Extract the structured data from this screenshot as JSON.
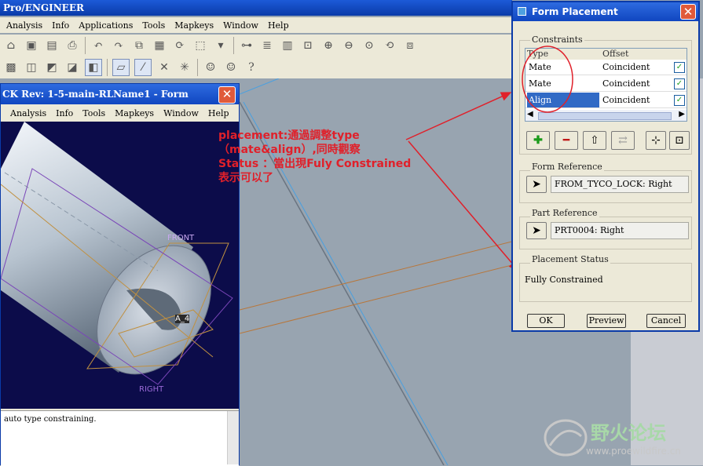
{
  "main_window": {
    "title": "Pro/ENGINEER",
    "menu": [
      "Analysis",
      "Info",
      "Applications",
      "Tools",
      "Mapkeys",
      "Window",
      "Help"
    ]
  },
  "form_window": {
    "title": "CK Rev: 1-5-main-RLName1 - Form",
    "menu": [
      "Analysis",
      "Info",
      "Tools",
      "Mapkeys",
      "Window",
      "Help"
    ],
    "close": "✕",
    "datum_labels": {
      "front": "FRONT",
      "right": "RIGHT",
      "axis": "A_4"
    },
    "message": "auto type constraining."
  },
  "dialog": {
    "title": "Form Placement",
    "close": "✕",
    "constraints_label": "Constraints",
    "columns": {
      "type": "Type",
      "offset": "Offset"
    },
    "rows": [
      {
        "type": "Mate",
        "offset": "Coincident",
        "checked": "✓"
      },
      {
        "type": "Mate",
        "offset": "Coincident",
        "checked": "✓"
      },
      {
        "type": "Align",
        "offset": "Coincident",
        "checked": "✓"
      }
    ],
    "form_reference_label": "Form Reference",
    "form_reference_value": "FROM_TYCO_LOCK: Right",
    "part_reference_label": "Part Reference",
    "part_reference_value": "PRT0004: Right",
    "placement_status_label": "Placement Status",
    "placement_status_value": "Fully Constrained",
    "ok": "OK",
    "preview": "Preview",
    "cancel": "Cancel"
  },
  "annotation": {
    "line1": "placement:通過調整type",
    "line2": "（mate&align）,同時觀察",
    "line3": "Status ：當出現Fuly Constrained",
    "line4": "表示可以了"
  },
  "watermark": {
    "title": "野火论坛",
    "url": "www.proewildfire.cn"
  },
  "colors": {
    "title_bar": "#1046c0",
    "annotation_red": "#e0202a",
    "selection": "#316ac5",
    "graphics_bg": "#0c0c4a"
  }
}
